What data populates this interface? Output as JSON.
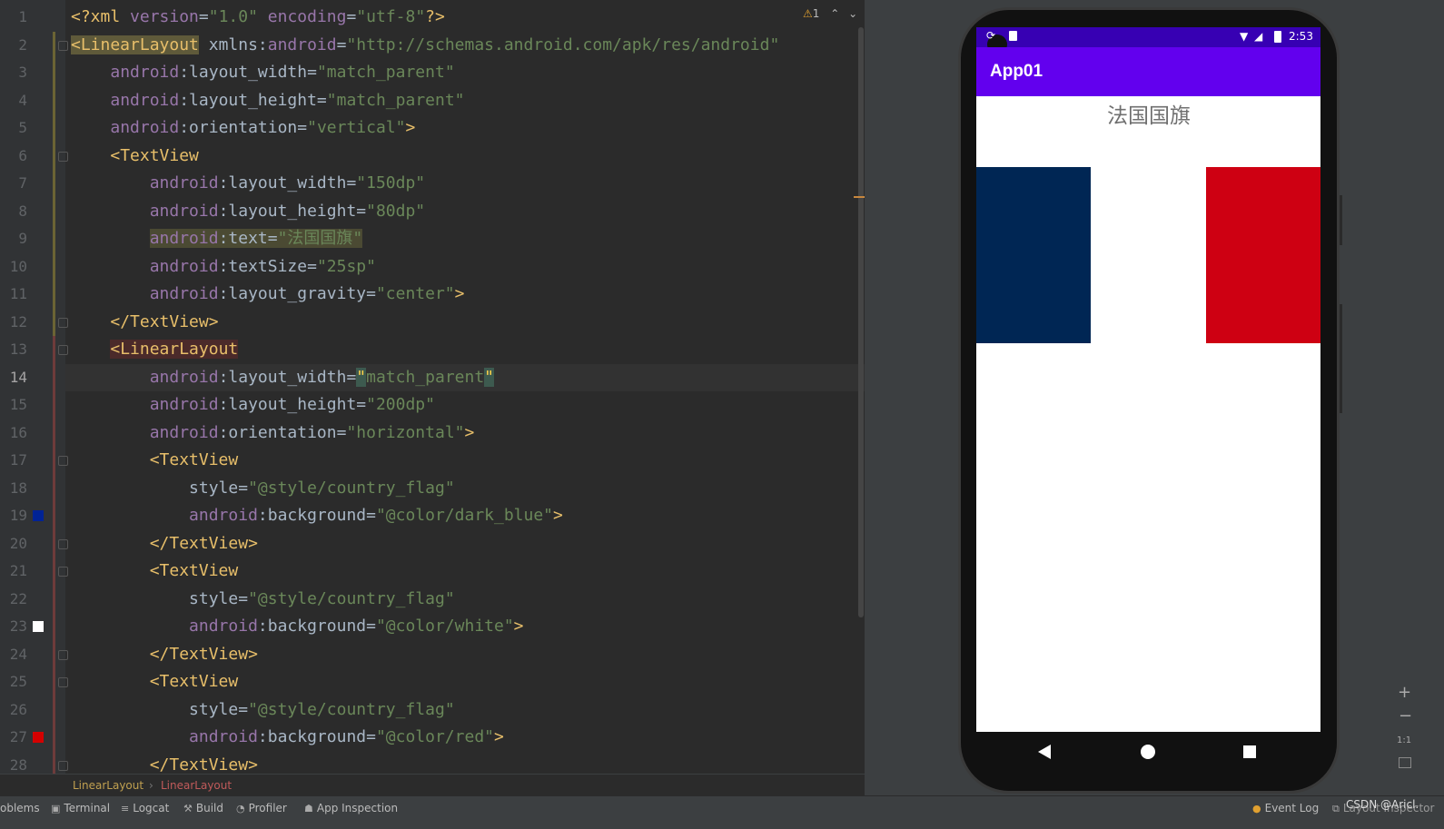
{
  "editor": {
    "warning_count": "1",
    "current_line": 14,
    "lines": [
      {
        "n": "1",
        "segments": [
          [
            "t",
            "<?xml "
          ],
          [
            "a",
            "version"
          ],
          [
            "p",
            "="
          ],
          [
            "v",
            "\"1.0\""
          ],
          [
            "p",
            " "
          ],
          [
            "a",
            "encoding"
          ],
          [
            "p",
            "="
          ],
          [
            "v",
            "\"utf-8\""
          ],
          [
            "t",
            "?>"
          ]
        ]
      },
      {
        "n": "2",
        "segments": [
          [
            "tag-hl",
            "<LinearLayout"
          ],
          [
            "p",
            " xmlns:"
          ],
          [
            "a",
            "android"
          ],
          [
            "p",
            "="
          ],
          [
            "v",
            "\"http://schemas.android.com/apk/res/android\""
          ]
        ]
      },
      {
        "n": "3",
        "segments": [
          [
            "p",
            "    "
          ],
          [
            "a",
            "android"
          ],
          [
            "p",
            ":layout_width="
          ],
          [
            "v",
            "\"match_parent\""
          ]
        ]
      },
      {
        "n": "4",
        "segments": [
          [
            "p",
            "    "
          ],
          [
            "a",
            "android"
          ],
          [
            "p",
            ":layout_height="
          ],
          [
            "v",
            "\"match_parent\""
          ]
        ]
      },
      {
        "n": "5",
        "segments": [
          [
            "p",
            "    "
          ],
          [
            "a",
            "android"
          ],
          [
            "p",
            ":orientation="
          ],
          [
            "v",
            "\"vertical\""
          ],
          [
            "t",
            ">"
          ]
        ]
      },
      {
        "n": "6",
        "segments": [
          [
            "p",
            "    "
          ],
          [
            "t",
            "<TextView"
          ]
        ]
      },
      {
        "n": "7",
        "segments": [
          [
            "p",
            "        "
          ],
          [
            "a",
            "android"
          ],
          [
            "p",
            ":layout_width="
          ],
          [
            "v",
            "\"150dp\""
          ]
        ]
      },
      {
        "n": "8",
        "segments": [
          [
            "p",
            "        "
          ],
          [
            "a",
            "android"
          ],
          [
            "p",
            ":layout_height="
          ],
          [
            "v",
            "\"80dp\""
          ]
        ]
      },
      {
        "n": "9",
        "segments": [
          [
            "p",
            "        "
          ],
          [
            "sel-a",
            "android"
          ],
          [
            "sel-p",
            ":text="
          ],
          [
            "sel-v",
            "\"法国国旗\""
          ]
        ]
      },
      {
        "n": "10",
        "segments": [
          [
            "p",
            "        "
          ],
          [
            "a",
            "android"
          ],
          [
            "p",
            ":textSize="
          ],
          [
            "v",
            "\"25sp\""
          ]
        ]
      },
      {
        "n": "11",
        "segments": [
          [
            "p",
            "        "
          ],
          [
            "a",
            "android"
          ],
          [
            "p",
            ":layout_gravity="
          ],
          [
            "v",
            "\"center\""
          ],
          [
            "t",
            ">"
          ]
        ]
      },
      {
        "n": "12",
        "segments": [
          [
            "p",
            "    "
          ],
          [
            "t",
            "</TextView>"
          ]
        ]
      },
      {
        "n": "13",
        "segments": [
          [
            "p",
            "    "
          ],
          [
            "red-hl",
            "<LinearLayout"
          ]
        ]
      },
      {
        "n": "14",
        "segments": [
          [
            "p",
            "        "
          ],
          [
            "a",
            "android"
          ],
          [
            "p",
            ":layout_width="
          ],
          [
            "caret",
            "\""
          ],
          [
            "v",
            "match_parent"
          ],
          [
            "caret",
            "\""
          ]
        ]
      },
      {
        "n": "15",
        "segments": [
          [
            "p",
            "        "
          ],
          [
            "a",
            "android"
          ],
          [
            "p",
            ":layout_height="
          ],
          [
            "v",
            "\"200dp\""
          ]
        ]
      },
      {
        "n": "16",
        "segments": [
          [
            "p",
            "        "
          ],
          [
            "a",
            "android"
          ],
          [
            "p",
            ":orientation="
          ],
          [
            "v",
            "\"horizontal\""
          ],
          [
            "t",
            ">"
          ]
        ]
      },
      {
        "n": "17",
        "segments": [
          [
            "p",
            "        "
          ],
          [
            "t",
            "<TextView"
          ]
        ]
      },
      {
        "n": "18",
        "segments": [
          [
            "p",
            "            style="
          ],
          [
            "v",
            "\"@style/country_flag\""
          ]
        ]
      },
      {
        "n": "19",
        "segments": [
          [
            "p",
            "            "
          ],
          [
            "a",
            "android"
          ],
          [
            "p",
            ":background="
          ],
          [
            "v",
            "\"@color/dark_blue\""
          ],
          [
            "t",
            ">"
          ]
        ]
      },
      {
        "n": "20",
        "segments": [
          [
            "p",
            "        "
          ],
          [
            "t",
            "</TextView>"
          ]
        ]
      },
      {
        "n": "21",
        "segments": [
          [
            "p",
            "        "
          ],
          [
            "t",
            "<TextView"
          ]
        ]
      },
      {
        "n": "22",
        "segments": [
          [
            "p",
            "            style="
          ],
          [
            "v",
            "\"@style/country_flag\""
          ]
        ]
      },
      {
        "n": "23",
        "segments": [
          [
            "p",
            "            "
          ],
          [
            "a",
            "android"
          ],
          [
            "p",
            ":background="
          ],
          [
            "v",
            "\"@color/white\""
          ],
          [
            "t",
            ">"
          ]
        ]
      },
      {
        "n": "24",
        "segments": [
          [
            "p",
            "        "
          ],
          [
            "t",
            "</TextView>"
          ]
        ]
      },
      {
        "n": "25",
        "segments": [
          [
            "p",
            "        "
          ],
          [
            "t",
            "<TextView"
          ]
        ]
      },
      {
        "n": "26",
        "segments": [
          [
            "p",
            "            style="
          ],
          [
            "v",
            "\"@style/country_flag\""
          ]
        ]
      },
      {
        "n": "27",
        "segments": [
          [
            "p",
            "            "
          ],
          [
            "a",
            "android"
          ],
          [
            "p",
            ":background="
          ],
          [
            "v",
            "\"@color/red\""
          ],
          [
            "t",
            ">"
          ]
        ]
      },
      {
        "n": "28",
        "segments": [
          [
            "p",
            "        "
          ],
          [
            "t",
            "</TextView>"
          ]
        ]
      }
    ],
    "color_swatches": [
      {
        "line": 19,
        "color": "#002395"
      },
      {
        "line": 23,
        "color": "#ffffff"
      },
      {
        "line": 27,
        "color": "#d40000"
      }
    ]
  },
  "breadcrumb": {
    "item1": "LinearLayout",
    "item2": "LinearLayout"
  },
  "emulator": {
    "status_time": "2:53",
    "app_title": "App01",
    "flag_title": "法国国旗",
    "flag_colors": {
      "blue": "#002654",
      "white": "#ffffff",
      "red": "#ce0012"
    },
    "appbar_color": "#6200ee",
    "statusbar_color": "#3700b3"
  },
  "zoom_tools": {
    "ratio": "1:1"
  },
  "bottom_bar": {
    "tabs": [
      "oblems",
      "Terminal",
      "Logcat",
      "Build",
      "Profiler",
      "App Inspection"
    ],
    "right": [
      "Event Log",
      "Layout Inspector"
    ],
    "watermark": "CSDN @Aricl."
  }
}
